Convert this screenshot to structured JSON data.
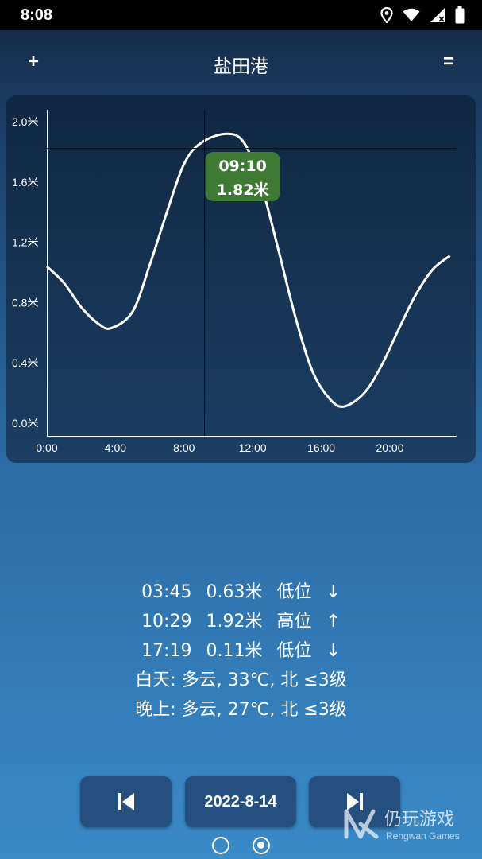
{
  "status_bar": {
    "time": "8:08",
    "icons": [
      "location-icon",
      "wifi-icon",
      "signal-icon",
      "battery-icon"
    ]
  },
  "app_bar": {
    "add_label": "+",
    "title": "盐田港",
    "menu_label": "="
  },
  "chart_data": {
    "type": "line",
    "title": "",
    "xlabel": "",
    "ylabel": "",
    "x_ticks": [
      "0:00",
      "4:00",
      "8:00",
      "12:00",
      "16:00",
      "20:00"
    ],
    "y_ticks": [
      "0.0米",
      "0.4米",
      "0.8米",
      "1.2米",
      "1.6米",
      "2.0米"
    ],
    "xlim": [
      0,
      24
    ],
    "ylim": [
      0,
      2.0
    ],
    "grid": false,
    "series": [
      {
        "x": [
          0,
          1,
          2,
          3,
          3.75,
          5,
          6,
          7,
          8,
          9,
          10.48,
          11.5,
          12.5,
          13.5,
          14.5,
          15.5,
          16.5,
          17.32,
          18.5,
          19.5,
          20.5,
          21.5,
          22.5,
          23.5
        ],
        "values": [
          1.04,
          0.93,
          0.77,
          0.66,
          0.63,
          0.74,
          1.05,
          1.4,
          1.72,
          1.86,
          1.92,
          1.86,
          1.58,
          1.15,
          0.7,
          0.34,
          0.16,
          0.11,
          0.2,
          0.38,
          0.62,
          0.85,
          1.02,
          1.11
        ]
      }
    ],
    "crosshair": {
      "x": 9.17,
      "y": 1.82
    },
    "tooltip": {
      "time": "09:10",
      "height": "1.82米"
    },
    "colors": {
      "line": "#ffffff",
      "tooltip_bg": "#3e7a34",
      "crosshair": "#0a0f14"
    }
  },
  "tides": [
    {
      "time": "03:45",
      "height": "0.63米",
      "type": "低位",
      "arrow": "↓"
    },
    {
      "time": "10:29",
      "height": "1.92米",
      "type": "高位",
      "arrow": "↑"
    },
    {
      "time": "17:19",
      "height": "0.11米",
      "type": "低位",
      "arrow": "↓"
    }
  ],
  "weather": {
    "day": "白天: 多云, 33℃, 北 ≤3级",
    "night": "晚上: 多云, 27℃, 北 ≤3级"
  },
  "navigation": {
    "prev_icon": "skip-previous-icon",
    "date": "2022-8-14",
    "next_icon": "skip-next-icon"
  },
  "page_indicator": {
    "count": 2,
    "active": 1
  },
  "watermark": {
    "cn": "仍玩游戏",
    "en": "Rengwan Games"
  }
}
